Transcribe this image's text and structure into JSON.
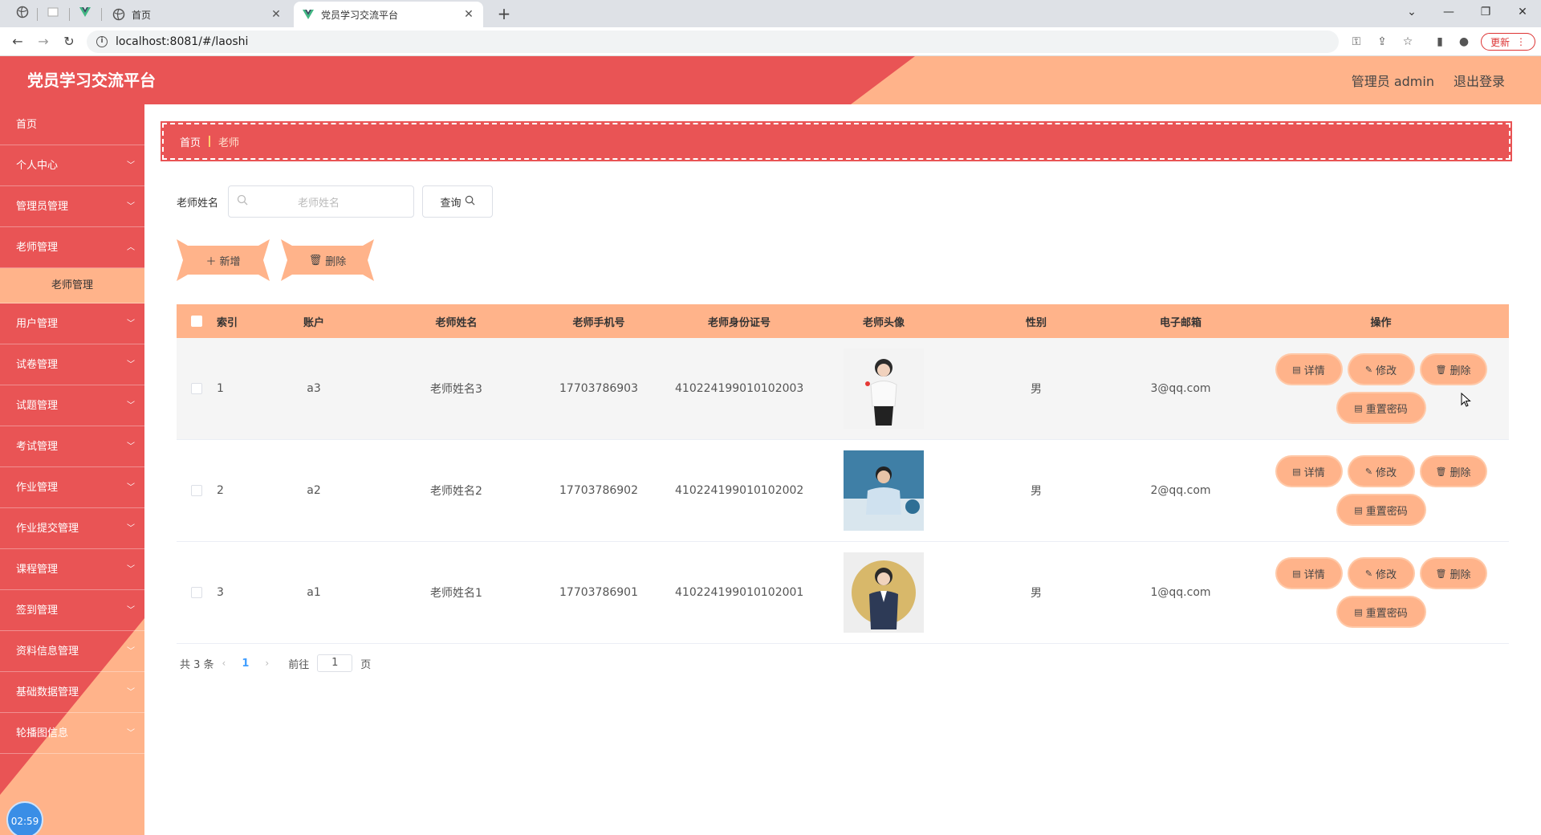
{
  "browser": {
    "tabs": [
      {
        "title": "首页",
        "active": false
      },
      {
        "title": "党员学习交流平台",
        "active": true
      }
    ],
    "url": "localhost:8081/#/laoshi",
    "update_label": "更新"
  },
  "header": {
    "title": "党员学习交流平台",
    "user_label": "管理员 admin",
    "logout_label": "退出登录"
  },
  "sidebar": {
    "items": [
      {
        "label": "首页",
        "has_children": false
      },
      {
        "label": "个人中心",
        "has_children": true
      },
      {
        "label": "管理员管理",
        "has_children": true
      },
      {
        "label": "老师管理",
        "has_children": true,
        "expanded": true,
        "sub": "老师管理"
      },
      {
        "label": "用户管理",
        "has_children": true
      },
      {
        "label": "试卷管理",
        "has_children": true
      },
      {
        "label": "试题管理",
        "has_children": true
      },
      {
        "label": "考试管理",
        "has_children": true
      },
      {
        "label": "作业管理",
        "has_children": true
      },
      {
        "label": "作业提交管理",
        "has_children": true
      },
      {
        "label": "课程管理",
        "has_children": true
      },
      {
        "label": "签到管理",
        "has_children": true
      },
      {
        "label": "资料信息管理",
        "has_children": true
      },
      {
        "label": "基础数据管理",
        "has_children": true
      },
      {
        "label": "轮播图信息",
        "has_children": true
      }
    ],
    "clock": "02:59"
  },
  "breadcrumb": {
    "home": "首页",
    "current": "老师"
  },
  "search": {
    "label": "老师姓名",
    "placeholder": "老师姓名",
    "button": "查询"
  },
  "actions": {
    "add": "新增",
    "delete": "删除"
  },
  "table": {
    "columns": [
      "索引",
      "账户",
      "老师姓名",
      "老师手机号",
      "老师身份证号",
      "老师头像",
      "性别",
      "电子邮箱",
      "操作"
    ],
    "rows": [
      {
        "index": "1",
        "account": "a3",
        "name": "老师姓名3",
        "phone": "17703786903",
        "id_card": "410224199010102003",
        "avatar": "teacher-avatar-3",
        "sex": "男",
        "email": "3@qq.com"
      },
      {
        "index": "2",
        "account": "a2",
        "name": "老师姓名2",
        "phone": "17703786902",
        "id_card": "410224199010102002",
        "avatar": "teacher-avatar-2",
        "sex": "男",
        "email": "2@qq.com"
      },
      {
        "index": "3",
        "account": "a1",
        "name": "老师姓名1",
        "phone": "17703786901",
        "id_card": "410224199010102001",
        "avatar": "teacher-avatar-1",
        "sex": "男",
        "email": "1@qq.com"
      }
    ],
    "ops": {
      "detail": "详情",
      "edit": "修改",
      "delete": "删除",
      "reset": "重置密码"
    }
  },
  "pagination": {
    "total": "共 3 条",
    "current": "1",
    "goto_prefix": "前往",
    "goto_value": "1",
    "goto_suffix": "页"
  },
  "colors": {
    "primary_red": "#e95455",
    "accent_peach": "#ffb38a"
  }
}
